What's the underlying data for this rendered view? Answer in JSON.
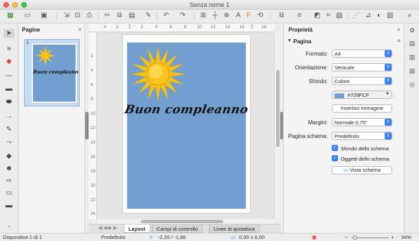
{
  "window": {
    "title": "Senza nome 1"
  },
  "toolbar": {
    "icons": [
      "new-document-icon",
      "open-folder-icon",
      "save-icon",
      "export-icon",
      "print-icon",
      "cut-icon",
      "copy-icon",
      "paste-icon",
      "clone-format-icon",
      "undo-icon",
      "redo-icon",
      "grid-icon",
      "helplines-icon",
      "zoom-icon",
      "text-icon",
      "fontwork-icon",
      "transform-icon",
      "align-icon",
      "arrange-icon",
      "shadow-icon",
      "crop-icon",
      "filter-icon",
      "points-icon",
      "glue-icon",
      "toggle-3d-icon",
      "more-icon"
    ]
  },
  "pages_panel": {
    "title": "Pagine",
    "close_label": "×",
    "thumbnail": {
      "number": "1",
      "text": "Buon compleanno"
    }
  },
  "ruler": {
    "top_ticks": [
      "4",
      "2",
      "2",
      "4",
      "6",
      "8",
      "10",
      "12",
      "14",
      "16",
      "18"
    ],
    "left_ticks": [
      "2",
      "4",
      "6",
      "8",
      "10",
      "12",
      "14",
      "16",
      "18",
      "20",
      "22",
      "24"
    ]
  },
  "canvas": {
    "page_background": "#729FCF",
    "text": "Buon compleanno"
  },
  "tabs": {
    "nav": "◀ ◀ ▶ ▶",
    "items": [
      "Layout",
      "Campi di controllo",
      "Linee di quotatura"
    ]
  },
  "properties": {
    "title": "Proprietà",
    "close_label": "×",
    "section": "Pagina",
    "formato": {
      "label": "Formato:",
      "value": "A4"
    },
    "orientazione": {
      "label": "Orientazione:",
      "value": "Verticale"
    },
    "sfondo": {
      "label": "Sfondo:",
      "value": "Colore"
    },
    "color": {
      "value": "#729FCF"
    },
    "insert_image": "Inserisci immagine",
    "margini": {
      "label": "Margini:",
      "value": "Normale 0,75\""
    },
    "schema": {
      "label": "Pagina schema:",
      "value": "Predefinito"
    },
    "check_sfondo": "Sfondo dello schema",
    "check_oggetti": "Oggetti dello schema",
    "vista_schema": "Vista schema"
  },
  "statusbar": {
    "slide": "Diapositiva 1 di 1",
    "layout": "Predefinito",
    "position": "-2,26 / -1,86",
    "size": "0,00 x 0,00",
    "zoom_minus": "−",
    "zoom_plus": "+",
    "zoom": "34%"
  }
}
